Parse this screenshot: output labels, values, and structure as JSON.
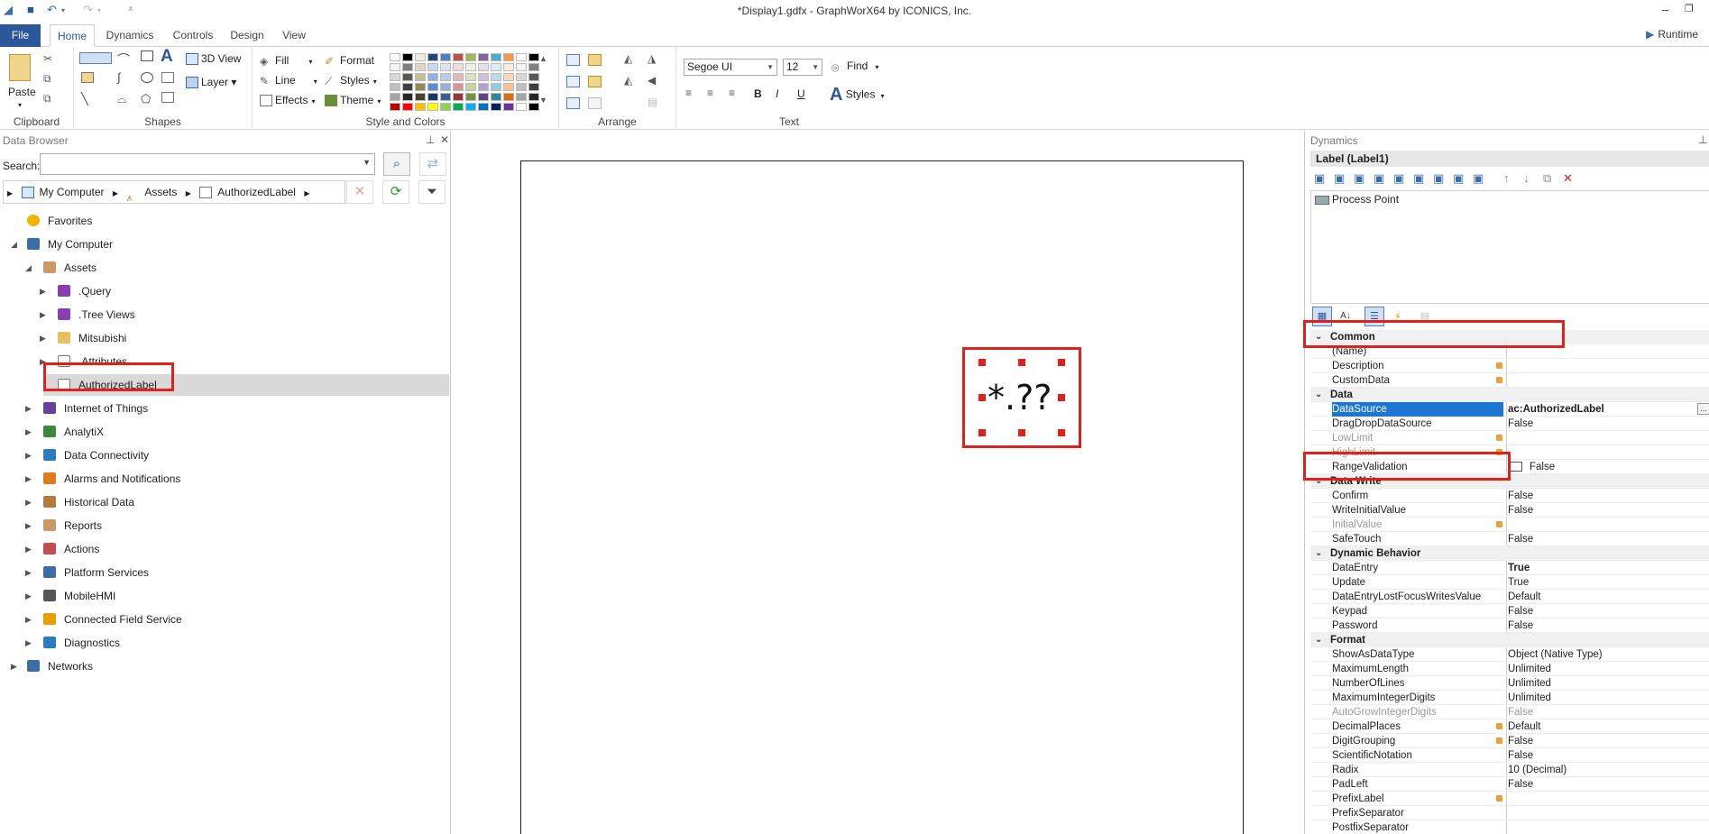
{
  "window": {
    "title": "*Display1.gdfx - GraphWorX64 by ICONICS, Inc."
  },
  "tabs": [
    {
      "label": "File"
    },
    {
      "label": "Home"
    },
    {
      "label": "Dynamics"
    },
    {
      "label": "Controls"
    },
    {
      "label": "Design"
    },
    {
      "label": "View"
    }
  ],
  "runtime_label": "Runtime",
  "ribbon": {
    "clipboard": {
      "group": "Clipboard",
      "paste": "Paste"
    },
    "shapes": {
      "group": "Shapes",
      "view3d": "3D View",
      "layer": "Layer"
    },
    "style": {
      "group": "Style and Colors",
      "fill": "Fill",
      "line": "Line",
      "effects": "Effects",
      "format": "Format",
      "styles": "Styles",
      "theme": "Theme"
    },
    "arrange": {
      "group": "Arrange"
    },
    "text": {
      "group": "Text",
      "font": "Segoe UI",
      "size": "12",
      "find": "Find",
      "styles": "Styles",
      "bold": "B",
      "italic": "I",
      "underline": "U"
    }
  },
  "palette": [
    "#ffffff",
    "#000000",
    "#eeece1",
    "#1f497d",
    "#4f81bd",
    "#c0504d",
    "#9bbb59",
    "#8064a2",
    "#4bacc6",
    "#f79646",
    "#ffffff",
    "#000000",
    "#f2f2f2",
    "#7f7f7f",
    "#ddd9c3",
    "#c6d9f0",
    "#dbe5f1",
    "#f2dcdb",
    "#ebf1dd",
    "#e5e0ec",
    "#dbeef3",
    "#fdeada",
    "#f2f2f2",
    "#7f7f7f",
    "#d8d8d8",
    "#595959",
    "#c4bd97",
    "#8db3e2",
    "#b8cce4",
    "#e5b9b7",
    "#d7e3bc",
    "#ccc1d9",
    "#b7dde8",
    "#fbd5b5",
    "#d8d8d8",
    "#595959",
    "#bfbfbf",
    "#3f3f3f",
    "#938953",
    "#548dd4",
    "#95b3d7",
    "#d99694",
    "#c3d69b",
    "#b2a2c7",
    "#92cddc",
    "#fac08f",
    "#bfbfbf",
    "#3f3f3f",
    "#a5a5a5",
    "#262626",
    "#494429",
    "#17365d",
    "#366092",
    "#953734",
    "#76923c",
    "#5f497a",
    "#31859b",
    "#e36c09",
    "#a5a5a5",
    "#262626",
    "#c00000",
    "#ff0000",
    "#ffc000",
    "#ffff00",
    "#92d050",
    "#00b050",
    "#00b0f0",
    "#0070c0",
    "#002060",
    "#7030a0",
    "#ffffff",
    "#000000"
  ],
  "data_browser": {
    "title": "Data Browser",
    "search_label": "Search:",
    "search_value": "",
    "breadcrumb": [
      "My Computer",
      "Assets",
      "AuthorizedLabel"
    ],
    "tree": [
      {
        "label": "Favorites",
        "icon": "star-icon"
      },
      {
        "label": "My Computer",
        "icon": "computer-icon"
      },
      {
        "label": "Assets",
        "icon": "assets-icon"
      },
      {
        "label": ".Query",
        "icon": "cube-icon"
      },
      {
        "label": ".Tree Views",
        "icon": "cube-icon"
      },
      {
        "label": "Mitsubishi",
        "icon": "folder-icon"
      },
      {
        "label": ".Attributes",
        "icon": "document-icon"
      },
      {
        "label": "AuthorizedLabel",
        "icon": "label-icon"
      },
      {
        "label": "Internet of Things",
        "icon": "iot-icon"
      },
      {
        "label": "AnalytiX",
        "icon": "analytix-icon"
      },
      {
        "label": "Data Connectivity",
        "icon": "connectivity-icon"
      },
      {
        "label": "Alarms and Notifications",
        "icon": "alarm-icon"
      },
      {
        "label": "Historical Data",
        "icon": "history-icon"
      },
      {
        "label": "Reports",
        "icon": "report-icon"
      },
      {
        "label": "Actions",
        "icon": "actions-icon"
      },
      {
        "label": "Platform Services",
        "icon": "platform-icon"
      },
      {
        "label": "MobileHMI",
        "icon": "mobile-icon"
      },
      {
        "label": "Connected Field Service",
        "icon": "field-service-icon"
      },
      {
        "label": "Diagnostics",
        "icon": "diagnostics-icon"
      },
      {
        "label": "Networks",
        "icon": "network-icon"
      }
    ]
  },
  "canvas": {
    "label_text": "*.??"
  },
  "dynamics": {
    "title": "Dynamics",
    "object_header": "Label (Label1)",
    "items": [
      "Process Point"
    ],
    "properties": [
      {
        "type": "cat",
        "name": "Common"
      },
      {
        "name": "(Name)",
        "value": ""
      },
      {
        "name": "Description",
        "value": "",
        "mark": true
      },
      {
        "name": "CustomData",
        "value": "",
        "mark": true
      },
      {
        "type": "cat",
        "name": "Data"
      },
      {
        "name": "DataSource",
        "value": "ac:AuthorizedLabel",
        "selected": true,
        "bold": true
      },
      {
        "name": "DragDropDataSource",
        "value": "False"
      },
      {
        "name": "LowLimit",
        "value": "",
        "mark": true,
        "dim": true
      },
      {
        "name": "HighLimit",
        "value": "",
        "mark": true,
        "dim": true
      },
      {
        "name": "RangeValidation",
        "value": "False",
        "checkbox": true
      },
      {
        "type": "cat",
        "name": "Data Write"
      },
      {
        "name": "Confirm",
        "value": "False"
      },
      {
        "name": "WriteInitialValue",
        "value": "False"
      },
      {
        "name": "InitialValue",
        "value": "",
        "mark": true,
        "dim": true
      },
      {
        "name": "SafeTouch",
        "value": "False"
      },
      {
        "type": "cat",
        "name": "Dynamic Behavior"
      },
      {
        "name": "DataEntry",
        "value": "True",
        "bold": true
      },
      {
        "name": "Update",
        "value": "True"
      },
      {
        "name": "DataEntryLostFocusWritesValue",
        "value": "Default"
      },
      {
        "name": "Keypad",
        "value": "False"
      },
      {
        "name": "Password",
        "value": "False"
      },
      {
        "type": "cat",
        "name": "Format"
      },
      {
        "name": "ShowAsDataType",
        "value": "Object (Native Type)"
      },
      {
        "name": "MaximumLength",
        "value": "Unlimited"
      },
      {
        "name": "NumberOfLines",
        "value": "Unlimited"
      },
      {
        "name": "MaximumIntegerDigits",
        "value": "Unlimited"
      },
      {
        "name": "AutoGrowIntegerDigits",
        "value": "False",
        "dim": true
      },
      {
        "name": "DecimalPlaces",
        "value": "Default",
        "mark": true
      },
      {
        "name": "DigitGrouping",
        "value": "False",
        "mark": true
      },
      {
        "name": "ScientificNotation",
        "value": "False"
      },
      {
        "name": "Radix",
        "value": "10 (Decimal)"
      },
      {
        "name": "PadLeft",
        "value": "False"
      },
      {
        "name": "PrefixLabel",
        "value": "",
        "mark": true
      },
      {
        "name": "PrefixSeparator",
        "value": ""
      },
      {
        "name": "PostfixSeparator",
        "value": ""
      }
    ]
  },
  "colors": {
    "accent": "#2b579a",
    "highlight": "#e0201b",
    "selection": "#1c76d2"
  }
}
